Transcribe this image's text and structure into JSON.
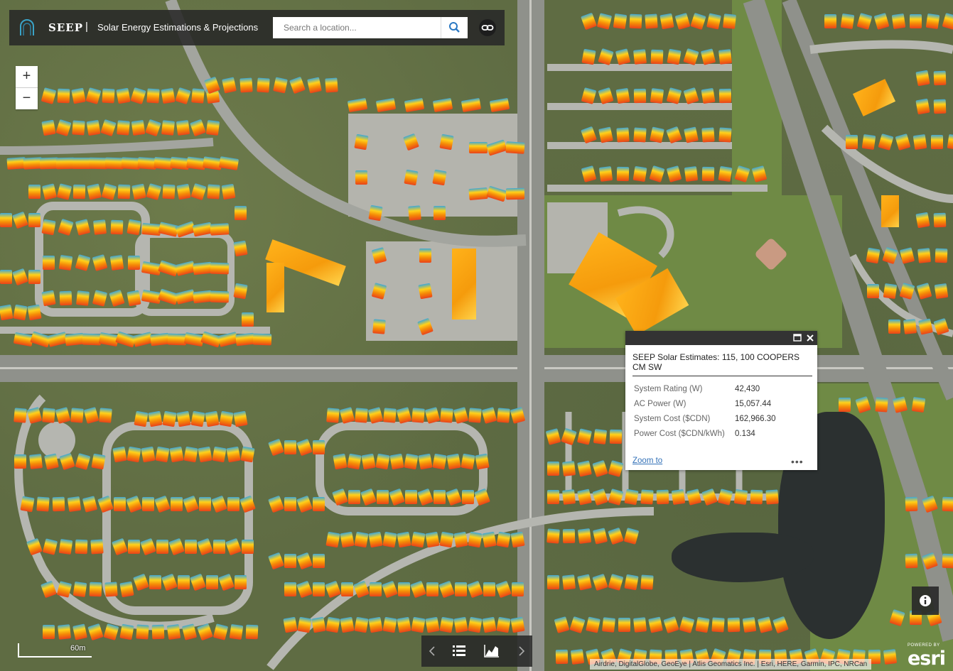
{
  "header": {
    "app_name": "SEEP",
    "separator": "|",
    "app_title": "Solar Energy Estimations & Projections",
    "search_placeholder": "Search a location...",
    "search_icon": "search-icon",
    "link_icon": "link-icon"
  },
  "zoom": {
    "in_label": "+",
    "out_label": "−"
  },
  "popup": {
    "title": "SEEP Solar Estimates: 115, 100 COOPERS CM SW",
    "attributes": [
      {
        "key": "System Rating (W)",
        "value": "42,430"
      },
      {
        "key": "AC Power (W)",
        "value": "15,057.44"
      },
      {
        "key": "System Cost ($CDN)",
        "value": "162,966.30"
      },
      {
        "key": "Power Cost ($CDN/kWh)",
        "value": "0.134"
      }
    ],
    "zoom_to_label": "Zoom to",
    "more_label": "•••"
  },
  "map": {
    "scale_label": "60m",
    "attribution": "Airdrie, DigitalGlobe, GeoEye | Atlis Geomatics Inc. | Esri, HERE, Garmin, IPC, NRCan",
    "powered_by": "POWERED BY",
    "esri": "esri"
  },
  "colors": {
    "toolbar_bg": "#282828",
    "solar_high": "#e9431b",
    "solar_mid": "#f58a07",
    "solar_low": "#3fa7d6",
    "link": "#3371b8"
  }
}
